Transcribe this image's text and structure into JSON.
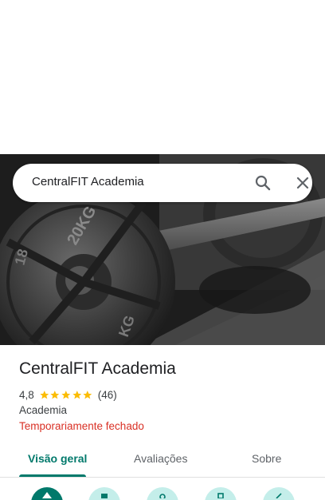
{
  "search": {
    "query": "CentralFIT Academia",
    "search_icon": "search-icon",
    "close_icon": "close-icon"
  },
  "photo": {
    "plate_lettering_top": "20KG",
    "plate_lettering_bottom": "KG",
    "plate_lettering_left": "18"
  },
  "place": {
    "name": "CentralFIT Academia",
    "rating": "4,8",
    "stars": 5,
    "review_count": "(46)",
    "category": "Academia",
    "status": "Temporariamente fechado"
  },
  "tabs": [
    {
      "label": "Visão geral",
      "active": true
    },
    {
      "label": "Avaliações",
      "active": false
    },
    {
      "label": "Sobre",
      "active": false
    }
  ],
  "actions": [
    {
      "icon": "directions-icon",
      "primary": true
    },
    {
      "icon": "save-icon",
      "primary": false
    },
    {
      "icon": "nearby-icon",
      "primary": false
    },
    {
      "icon": "phone-icon",
      "primary": false
    },
    {
      "icon": "share-icon",
      "primary": false
    }
  ],
  "colors": {
    "accent": "#00796b",
    "star": "#fbbc04",
    "status_closed": "#d93025",
    "action_secondary": "#c4eeea"
  }
}
